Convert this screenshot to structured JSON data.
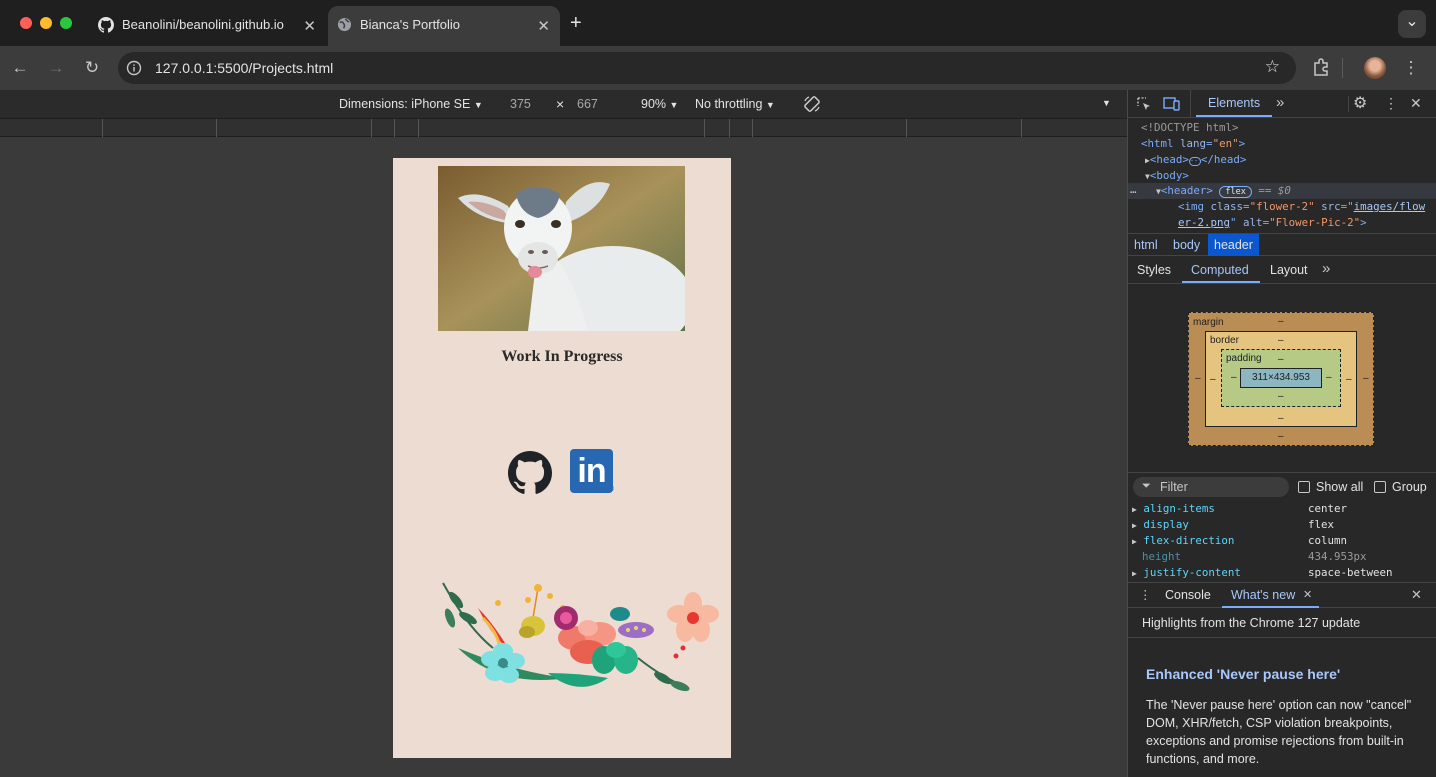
{
  "browser": {
    "tabs": [
      {
        "label": "Beanolini/beanolini.github.io",
        "active": false,
        "icon": "github-icon"
      },
      {
        "label": "Bianca's Portfolio",
        "active": true,
        "icon": "globe-icon"
      }
    ],
    "new_tab": "+",
    "tab_menu": "⌄",
    "url": "127.0.0.1:5500/Projects.html"
  },
  "device_toolbar": {
    "dimensions_label": "Dimensions: iPhone SE",
    "width": "375",
    "times": "×",
    "height": "667",
    "zoom": "90%",
    "throttling": "No throttling"
  },
  "page": {
    "heading": "Work In Progress",
    "image_alt": "goat",
    "social": [
      "github-icon",
      "linkedin-icon"
    ],
    "linkedin_text": "in",
    "registered": "®"
  },
  "devtools": {
    "top_tabs": [
      "Elements"
    ],
    "dom": {
      "doctype": "<!DOCTYPE html>",
      "html_open": "<html",
      "html_attr": "lang",
      "html_val": "\"en\"",
      "head": "<head>",
      "head_close": "</head>",
      "body": "<body>",
      "header": "<header>",
      "flex_badge": "flex",
      "eq": "== $0",
      "img_open": "<img",
      "img_class_attr": "class",
      "img_class_val": "\"flower-2\"",
      "img_src_attr": "src",
      "img_src_val_1": "images/flow",
      "img_src_val_2": "er-2.png",
      "img_alt_attr": "alt",
      "img_alt_val": "\"Flower-Pic-2\"",
      "img_close": ">"
    },
    "breadcrumbs": [
      "html",
      "body",
      "header"
    ],
    "panel_tabs": [
      "Styles",
      "Computed",
      "Layout"
    ],
    "active_panel_tab": "Computed",
    "box_model": {
      "margin": "margin",
      "border": "border",
      "padding": "padding",
      "content": "311×434.953",
      "dash": "–"
    },
    "filter_placeholder": "Filter",
    "show_all": "Show all",
    "group": "Group",
    "computed": [
      {
        "prop": "align-items",
        "value": "center",
        "expandable": true
      },
      {
        "prop": "display",
        "value": "flex",
        "expandable": true
      },
      {
        "prop": "flex-direction",
        "value": "column",
        "expandable": true
      },
      {
        "prop": "height",
        "value": "434.953px",
        "expandable": false
      },
      {
        "prop": "justify-content",
        "value": "space-between",
        "expandable": true
      }
    ],
    "drawer_tabs": [
      "Console",
      "What's new"
    ],
    "whats_new_subtitle": "Highlights from the Chrome 127 update",
    "whats_new_title": "Enhanced 'Never pause here'",
    "whats_new_body": "The 'Never pause here' option can now \"cancel\" DOM, XHR/fetch, CSP violation breakpoints, exceptions and promise rejections from built-in functions, and more."
  },
  "colors": {
    "page_bg": "#eddcd1",
    "accent": "#7cacf8",
    "linkedin": "#2867b2"
  }
}
